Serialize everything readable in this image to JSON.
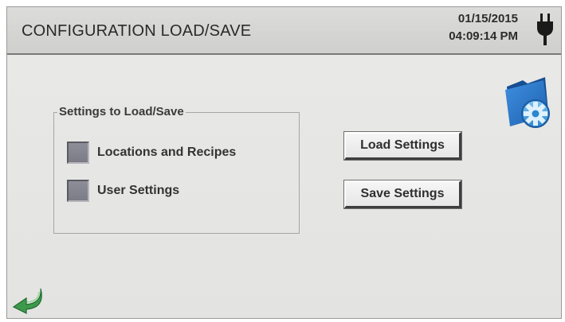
{
  "header": {
    "title": "CONFIGURATION LOAD/SAVE",
    "date": "01/15/2015",
    "time": "04:09:14 PM",
    "power_icon": "plug-icon"
  },
  "settings_group": {
    "legend": "Settings to Load/Save",
    "options": [
      {
        "label": "Locations and Recipes",
        "checked": false
      },
      {
        "label": "User Settings",
        "checked": false
      }
    ]
  },
  "actions": {
    "load_label": "Load Settings",
    "save_label": "Save Settings"
  },
  "icons": {
    "folder": "folder-gear-icon",
    "back": "back-arrow-icon"
  },
  "colors": {
    "accent_blue": "#2f7fd0",
    "back_arrow_green": "#3d9a4c",
    "checkbox_gray": "#858590"
  }
}
